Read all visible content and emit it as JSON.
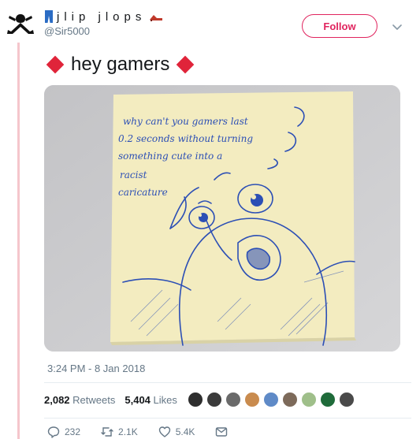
{
  "user": {
    "display_name": "jlip jlops",
    "handle": "@Sir5000"
  },
  "follow_label": "Follow",
  "tweet": {
    "text": "hey gamers",
    "timestamp": "3:24 PM - 8 Jan 2018"
  },
  "media": {
    "note_lines": [
      "why can't you gamers last",
      "0.2 seconds without turning",
      "something cute into a",
      "racist",
      "caricature"
    ]
  },
  "stats": {
    "retweets_count": "2,082",
    "retweets_label": "Retweets",
    "likes_count": "5,404",
    "likes_label": "Likes"
  },
  "actions": {
    "replies": "232",
    "retweets": "2.1K",
    "likes": "5.4K"
  },
  "colors": {
    "accent": "#e0245e",
    "diamond": "#e0243a",
    "thread": "#f5c6cc",
    "muted": "#657786"
  }
}
